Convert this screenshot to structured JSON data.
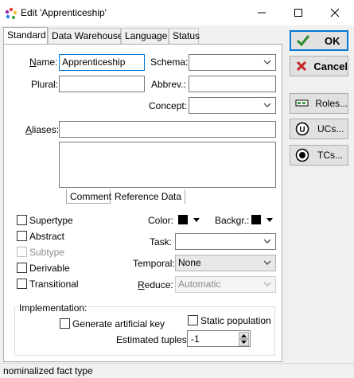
{
  "window": {
    "title": "Edit 'Apprenticeship'",
    "minimize_icon": "minimize-icon",
    "maximize_icon": "maximize-icon",
    "close_icon": "close-icon"
  },
  "tabs": [
    {
      "label": "Standard",
      "active": true
    },
    {
      "label": "Data Warehouse",
      "active": false
    },
    {
      "label": "Language",
      "active": false
    },
    {
      "label": "Status",
      "active": false
    }
  ],
  "form": {
    "name_label": "Name:",
    "name_value": "Apprenticeship",
    "plural_label": "Plural:",
    "plural_value": "",
    "schema_label": "Schema:",
    "schema_value": "",
    "abbrev_label": "Abbrev.:",
    "abbrev_value": "",
    "concept_label": "Concept:",
    "concept_value": "",
    "aliases_label": "Aliases:",
    "aliases_value": "",
    "comment_tab": "Comment",
    "reference_tab": "Reference Data",
    "supertype_label": "Supertype",
    "abstract_label": "Abstract",
    "subtype_label": "Subtype",
    "derivable_label": "Derivable",
    "transitional_label": "Transitional",
    "color_label": "Color:",
    "backgr_label": "Backgr.:",
    "task_label": "Task:",
    "task_value": "",
    "temporal_label": "Temporal:",
    "temporal_value": "None",
    "reduce_label": "Reduce:",
    "reduce_value": "Automatic",
    "implementation_label": "Implementation:",
    "generate_key_label": "Generate artificial key",
    "static_population_label": "Static population",
    "estimated_tuples_label": "Estimated tuples:",
    "estimated_tuples_value": "-1"
  },
  "buttons": {
    "ok": "OK",
    "cancel": "Cancel",
    "roles": "Roles...",
    "ucs": "UCs...",
    "tcs": "TCs..."
  },
  "status": {
    "text": "nominalized fact type"
  },
  "colors": {
    "accent": "#0078d7",
    "ok_check": "#2e8b2e",
    "cancel_x": "#c62828",
    "color_swatch": "#000000",
    "backgr_swatch": "#000000"
  }
}
